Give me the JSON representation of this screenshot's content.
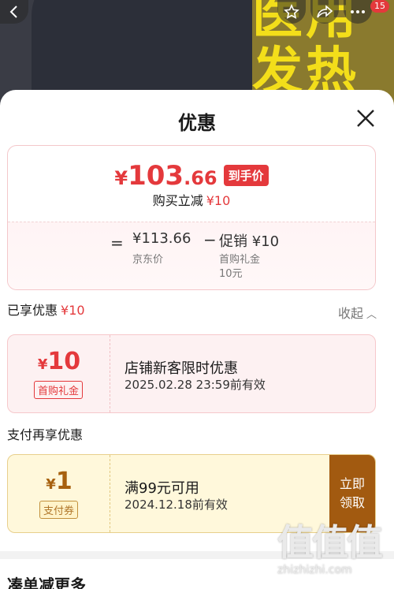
{
  "colors": {
    "accent": "#e4393c",
    "pay_accent": "#a25a10"
  },
  "background": {
    "big_text_1": "医用",
    "big_text_2": "发热"
  },
  "topbar": {
    "back_icon": "chevron-left-icon",
    "star_icon": "star-icon",
    "share_icon": "share-icon",
    "more_icon": "more-icon",
    "badge": "15"
  },
  "sheet": {
    "title": "优惠",
    "close_icon": "close-icon"
  },
  "price_card": {
    "currency": "¥",
    "price_int": "103",
    "price_dec": ".66",
    "final_tag": "到手价",
    "save_text": "购买立减",
    "save_amount": "¥10",
    "equals": "=",
    "jd_price": "¥113.66",
    "jd_label": "京东价",
    "minus": "−",
    "promo_title": "促销 ¥10",
    "promo_sub1": "首购礼金",
    "promo_sub2": "10元"
  },
  "enjoyed": {
    "label": "已享优惠",
    "amount": "¥10",
    "collapse_label": "收起"
  },
  "coupon": {
    "currency": "¥",
    "amount": "10",
    "tag": "首购礼金",
    "title": "店铺新客限时优惠",
    "expiry": "2025.02.28 23:59前有效"
  },
  "pay": {
    "label": "支付再享优惠",
    "currency": "¥",
    "amount": "1",
    "tag": "支付券",
    "title": "满99元可用",
    "expiry": "2024.12.18前有效",
    "claim_line1": "立即",
    "claim_line2": "领取"
  },
  "bottom": {
    "title": "凑单减更多"
  },
  "watermark": {
    "logo": "值值值",
    "url": "zhizhizhi.com"
  }
}
